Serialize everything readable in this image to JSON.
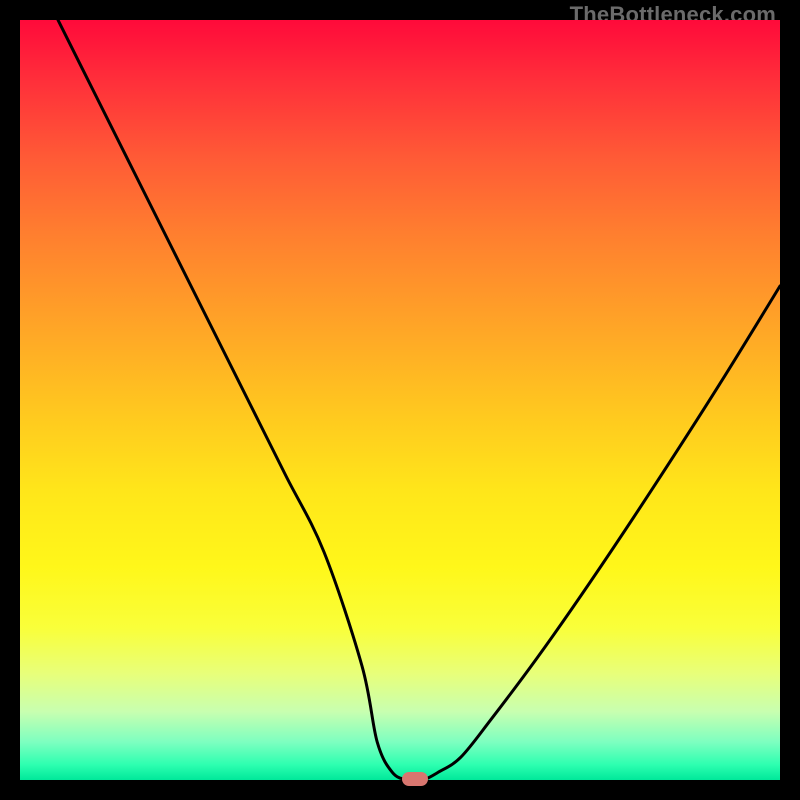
{
  "watermark": "TheBottleneck.com",
  "chart_data": {
    "type": "line",
    "title": "",
    "xlabel": "",
    "ylabel": "",
    "xlim": [
      0,
      100
    ],
    "ylim": [
      0,
      100
    ],
    "gradient_stops": [
      {
        "pos": 0,
        "color": "#ff0a3a"
      },
      {
        "pos": 18,
        "color": "#ff5a36"
      },
      {
        "pos": 40,
        "color": "#ffa427"
      },
      {
        "pos": 62,
        "color": "#ffe61a"
      },
      {
        "pos": 86,
        "color": "#e8ff7a"
      },
      {
        "pos": 100,
        "color": "#00e89a"
      }
    ],
    "series": [
      {
        "name": "bottleneck-curve",
        "x": [
          5,
          10,
          15,
          20,
          25,
          30,
          35,
          40,
          45,
          47,
          49,
          51,
          53,
          55,
          58,
          62,
          68,
          75,
          83,
          92,
          100
        ],
        "y": [
          100,
          90,
          80,
          70,
          60,
          50,
          40,
          30,
          15,
          5,
          1,
          0,
          0,
          1,
          3,
          8,
          16,
          26,
          38,
          52,
          65
        ]
      }
    ],
    "marker": {
      "x": 52,
      "y": 0,
      "color": "#d8766f"
    }
  }
}
